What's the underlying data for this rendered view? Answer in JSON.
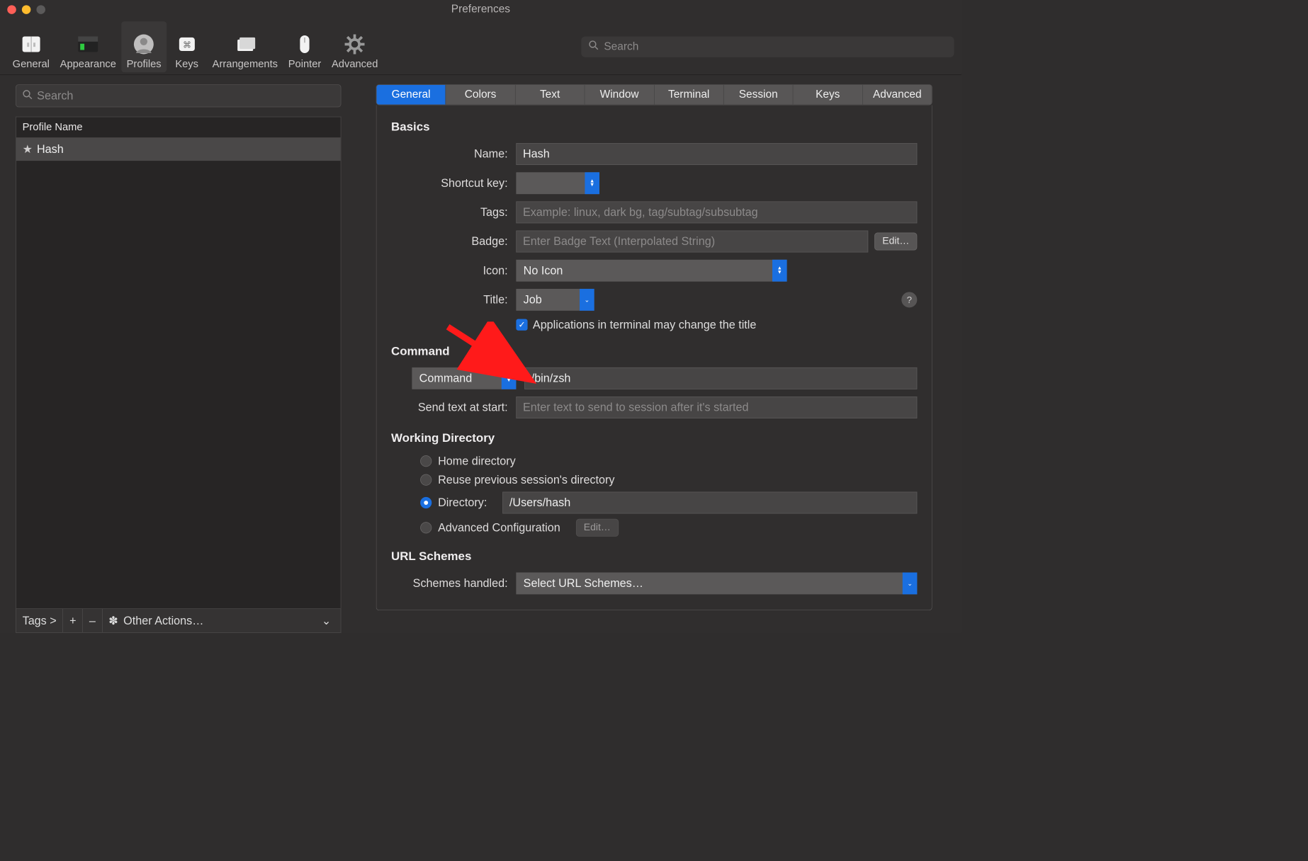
{
  "window": {
    "title": "Preferences"
  },
  "toolbar": {
    "items": [
      {
        "id": "general",
        "label": "General"
      },
      {
        "id": "appearance",
        "label": "Appearance"
      },
      {
        "id": "profiles",
        "label": "Profiles",
        "selected": true
      },
      {
        "id": "keys",
        "label": "Keys"
      },
      {
        "id": "arrangements",
        "label": "Arrangements"
      },
      {
        "id": "pointer",
        "label": "Pointer"
      },
      {
        "id": "advanced",
        "label": "Advanced"
      }
    ],
    "search_placeholder": "Search"
  },
  "sidebar": {
    "search_placeholder": "Search",
    "header": "Profile Name",
    "rows": [
      {
        "star": true,
        "name": "Hash"
      }
    ],
    "footer": {
      "tags_label": "Tags >",
      "plus": "+",
      "minus": "–",
      "other_actions": "Other Actions…"
    }
  },
  "tabs": [
    "General",
    "Colors",
    "Text",
    "Window",
    "Terminal",
    "Session",
    "Keys",
    "Advanced"
  ],
  "active_tab_index": 0,
  "panel": {
    "basics": {
      "heading": "Basics",
      "name_label": "Name:",
      "name_value": "Hash",
      "shortcut_label": "Shortcut key:",
      "shortcut_value": "",
      "tags_label": "Tags:",
      "tags_placeholder": "Example: linux, dark bg, tag/subtag/subsubtag",
      "badge_label": "Badge:",
      "badge_placeholder": "Enter Badge Text (Interpolated String)",
      "edit_button": "Edit…",
      "icon_label": "Icon:",
      "icon_value": "No Icon",
      "title_label": "Title:",
      "title_value": "Job",
      "help": "?",
      "apps_may_change": "Applications in terminal may change the title"
    },
    "command": {
      "heading": "Command",
      "mode_value": "Command",
      "command_value": "/bin/zsh",
      "send_text_label": "Send text at start:",
      "send_text_placeholder": "Enter text to send to session after it's started"
    },
    "working_dir": {
      "heading": "Working Directory",
      "home": "Home directory",
      "reuse": "Reuse previous session's directory",
      "directory_label": "Directory:",
      "directory_value": "/Users/hash",
      "advanced": "Advanced Configuration",
      "edit": "Edit…"
    },
    "url_schemes": {
      "heading": "URL Schemes",
      "label": "Schemes handled:",
      "value": "Select URL Schemes…"
    }
  }
}
